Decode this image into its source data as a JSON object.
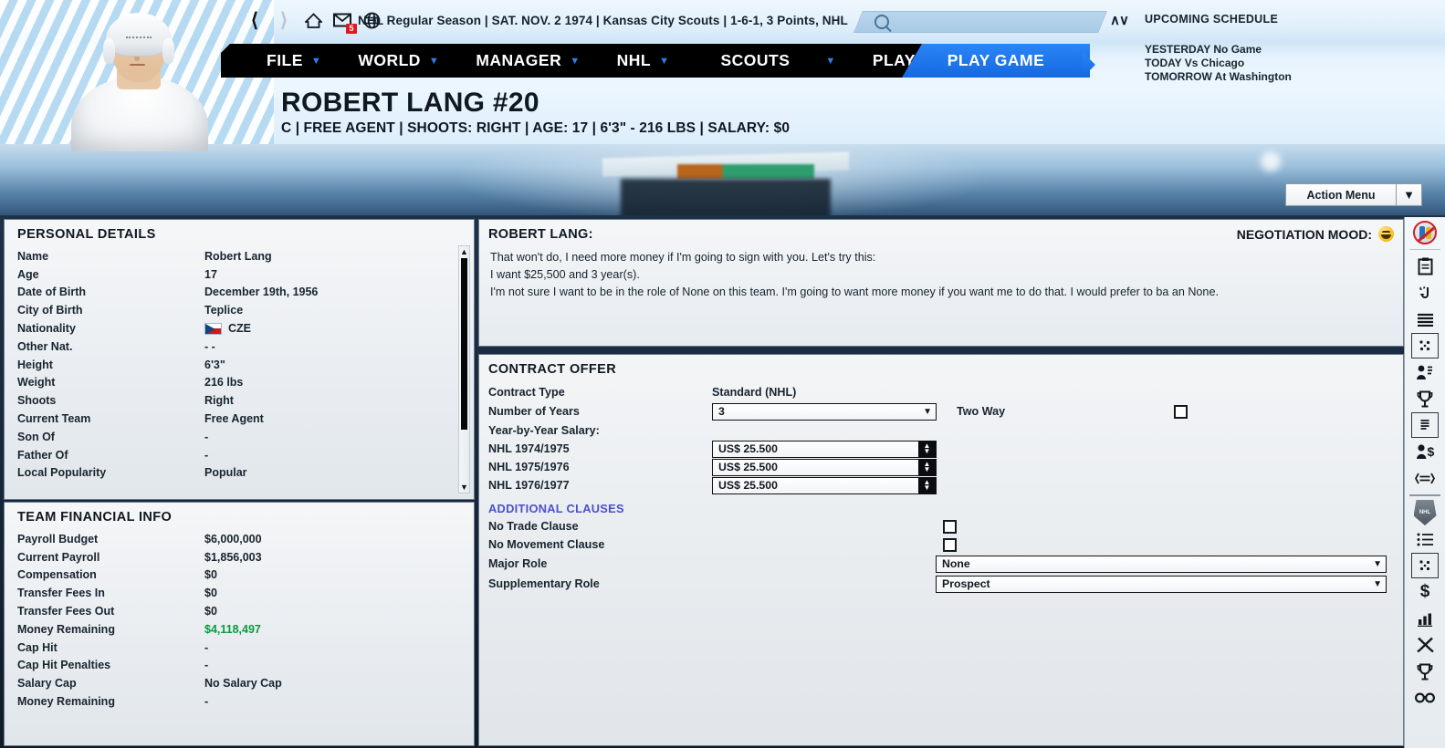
{
  "toolbar": {
    "back_icon": "chevron-left-icon",
    "forward_icon": "chevron-right-icon",
    "home_icon": "home-icon",
    "mail_icon": "mail-icon",
    "mail_badge": "5",
    "globe_icon": "globe-icon",
    "title": "NHL Regular Season | SAT. NOV. 2 1974 | Kansas City Scouts | 1-6-1, 3 Points, NHL",
    "search_placeholder": "",
    "updown_icon": "∧∨",
    "upcoming_title": "UPCOMING SCHEDULE",
    "schedule": [
      "YESTERDAY No Game",
      "TODAY Vs Chicago",
      "TOMORROW At Washington"
    ]
  },
  "menu": {
    "items": [
      {
        "label": "FILE",
        "caret": "▼"
      },
      {
        "label": "WORLD",
        "caret": "▼"
      },
      {
        "label": "MANAGER",
        "caret": "▼"
      },
      {
        "label": "NHL",
        "caret": "▼"
      },
      {
        "label": "SCOUTS",
        "caret": "▼"
      },
      {
        "label": "PLAY",
        "caret": "▼"
      }
    ],
    "play_game": "PLAY GAME"
  },
  "player_header": {
    "name": "ROBERT LANG #20",
    "subtitle": "C | FREE AGENT | SHOOTS: RIGHT | AGE: 17 | 6'3\" - 216 LBS | SALARY: $0"
  },
  "action_menu": {
    "label": "Action Menu",
    "caret": "▼"
  },
  "personal_details": {
    "title": "PERSONAL DETAILS",
    "rows": [
      {
        "key": "Name",
        "value": "Robert Lang"
      },
      {
        "key": "Age",
        "value": "17"
      },
      {
        "key": "Date of Birth",
        "value": "December 19th, 1956"
      },
      {
        "key": "City of Birth",
        "value": "Teplice"
      },
      {
        "key": "Nationality",
        "value": "CZE",
        "flag": "czech-flag"
      },
      {
        "key": "Other Nat.",
        "value": "-      -"
      },
      {
        "key": "Height",
        "value": "6'3\""
      },
      {
        "key": "Weight",
        "value": "216 lbs"
      },
      {
        "key": "Shoots",
        "value": "Right"
      },
      {
        "key": "Current Team",
        "value": "Free Agent"
      },
      {
        "key": "Son Of",
        "value": "-"
      },
      {
        "key": "Father Of",
        "value": "-"
      },
      {
        "key": "Local Popularity",
        "value": "Popular"
      }
    ]
  },
  "team_financial_info": {
    "title": "TEAM FINANCIAL INFO",
    "rows": [
      {
        "key": "Payroll Budget",
        "value": "$6,000,000"
      },
      {
        "key": "Current Payroll",
        "value": "$1,856,003"
      },
      {
        "key": "Compensation",
        "value": "$0"
      },
      {
        "key": "Transfer Fees In",
        "value": "$0"
      },
      {
        "key": "Transfer Fees Out",
        "value": "$0"
      },
      {
        "key": "Money Remaining",
        "value": "$4,118,497",
        "color": "#0a9a3c"
      },
      {
        "key": "Cap Hit",
        "value": "-"
      },
      {
        "key": "Cap Hit Penalties",
        "value": "-"
      },
      {
        "key": "Salary Cap",
        "value": "No Salary Cap"
      },
      {
        "key": "Money Remaining",
        "value": "-"
      }
    ]
  },
  "negotiation": {
    "speaker": "ROBERT LANG:",
    "mood_label": "NEGOTIATION MOOD:",
    "mood_icon": "smiling-face-emoji",
    "lines": [
      "That won't do, I need more money if I'm going to sign with you. Let's try this:",
      "I want $25,500 and 3 year(s).",
      "I'm not sure I want to be in the role of None on this team. I'm going to want more money if you want me to do that. I would prefer to ba an None."
    ]
  },
  "contract_offer": {
    "title": "CONTRACT OFFER",
    "contract_type_label": "Contract Type",
    "contract_type_value": "Standard (NHL)",
    "years_label": "Number of Years",
    "years_value": "3",
    "two_way_label": "Two Way",
    "two_way_checked": false,
    "year_by_year_label": "Year-by-Year Salary:",
    "salary_rows": [
      {
        "label": "NHL 1974/1975",
        "value": "US$ 25.500"
      },
      {
        "label": "NHL 1975/1976",
        "value": "US$ 25.500"
      },
      {
        "label": "NHL 1976/1977",
        "value": "US$ 25.500"
      }
    ],
    "clauses_title": "ADDITIONAL CLAUSES",
    "no_trade_label": "No Trade Clause",
    "no_trade_checked": false,
    "no_movement_label": "No Movement Clause",
    "no_movement_checked": false,
    "major_role_label": "Major Role",
    "major_role_value": "None",
    "supplementary_role_label": "Supplementary Role",
    "supplementary_role_value": "Prospect"
  },
  "rail": {
    "icons": [
      "no-entry-players-icon",
      "clipboard-icon",
      "transfer-arrow-icon",
      "list-lines-icon",
      "dice-icon",
      "people-speech-icon",
      "trophy-icon",
      "document-icon",
      "person-dollar-icon",
      "swap-icon"
    ],
    "icons2": [
      "nhl-shield-icon",
      "list-bullets-icon",
      "dice-square-icon",
      "dollar-icon",
      "bar-chart-icon",
      "sticks-icon",
      "trophy2-icon",
      "glasses-icon"
    ]
  },
  "colors": {
    "accent_blue": "#2a86f7",
    "menu_black": "#000000",
    "money_green": "#0a9a3c",
    "clause_purple": "#4b4fd0",
    "badge_red": "#e1181f"
  }
}
